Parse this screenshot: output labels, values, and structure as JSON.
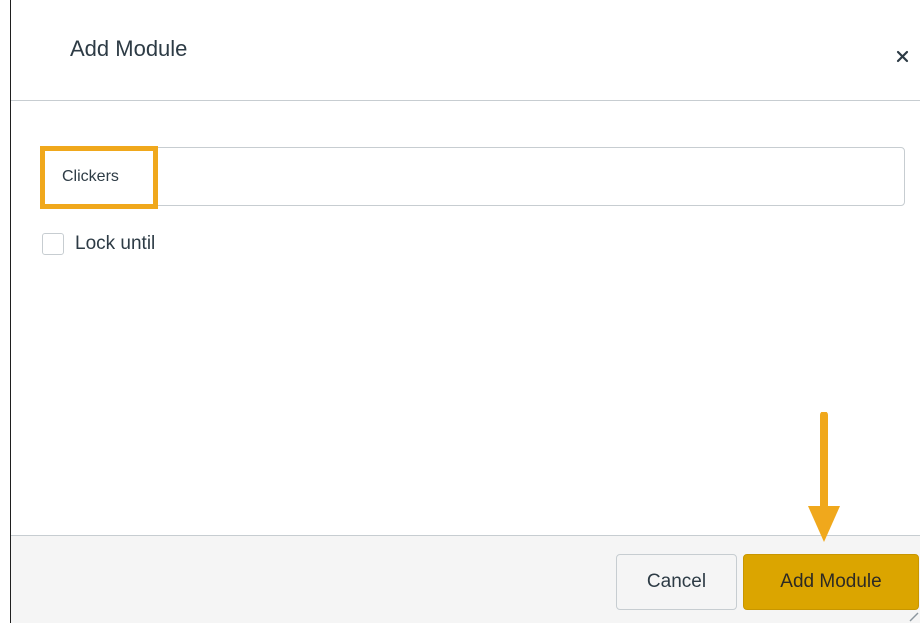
{
  "dialog": {
    "title": "Add Module",
    "close_icon": "close-icon",
    "close_glyph": "×"
  },
  "form": {
    "module_name": {
      "value": "Clickers",
      "placeholder": ""
    },
    "lock_until": {
      "label": "Lock until",
      "checked": false
    }
  },
  "footer": {
    "cancel_label": "Cancel",
    "submit_label": "Add Module"
  },
  "colors": {
    "highlight": "#f0a81c",
    "primary_button": "#dba500",
    "footer_background": "#f5f5f5",
    "border": "#c7cdd1"
  },
  "annotations": {
    "input_highlight": "highlight-box",
    "arrow": "down-arrow-icon"
  }
}
